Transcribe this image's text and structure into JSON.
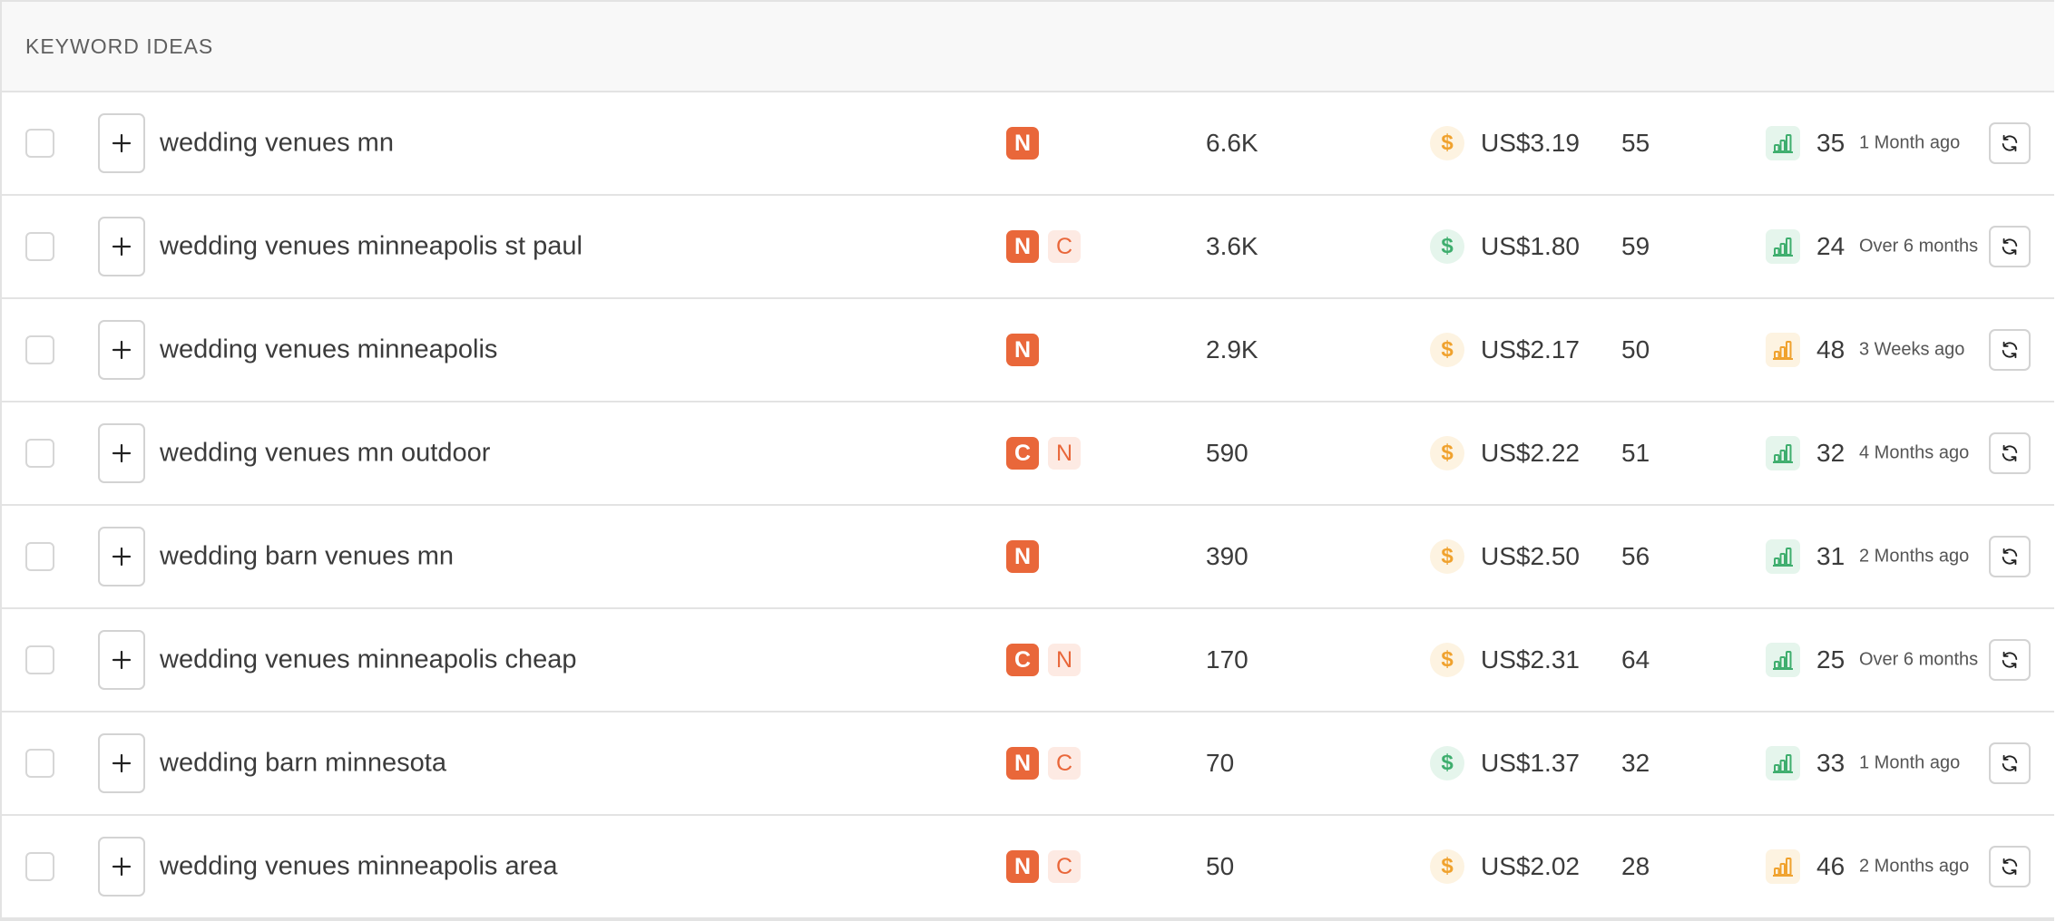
{
  "header": {
    "title": "KEYWORD IDEAS"
  },
  "colors": {
    "intent": "#e9673a",
    "green": "#3fae6e",
    "orange": "#f0a22e"
  },
  "rows": [
    {
      "keyword": "wedding venues mn",
      "intents": [
        "N"
      ],
      "volume": "6.6K",
      "cpc_level": "orange",
      "cpc": "US$3.19",
      "kd": "55",
      "trend_level": "green",
      "score": "35",
      "updated": "1 Month ago"
    },
    {
      "keyword": "wedding venues minneapolis st paul",
      "intents": [
        "N",
        "C"
      ],
      "volume": "3.6K",
      "cpc_level": "green",
      "cpc": "US$1.80",
      "kd": "59",
      "trend_level": "green",
      "score": "24",
      "updated": "Over 6 months"
    },
    {
      "keyword": "wedding venues minneapolis",
      "intents": [
        "N"
      ],
      "volume": "2.9K",
      "cpc_level": "orange",
      "cpc": "US$2.17",
      "kd": "50",
      "trend_level": "orange",
      "score": "48",
      "updated": "3 Weeks ago"
    },
    {
      "keyword": "wedding venues mn outdoor",
      "intents": [
        "C",
        "N"
      ],
      "volume": "590",
      "cpc_level": "orange",
      "cpc": "US$2.22",
      "kd": "51",
      "trend_level": "green",
      "score": "32",
      "updated": "4 Months ago"
    },
    {
      "keyword": "wedding barn venues mn",
      "intents": [
        "N"
      ],
      "volume": "390",
      "cpc_level": "orange",
      "cpc": "US$2.50",
      "kd": "56",
      "trend_level": "green",
      "score": "31",
      "updated": "2 Months ago"
    },
    {
      "keyword": "wedding venues minneapolis cheap",
      "intents": [
        "C",
        "N"
      ],
      "volume": "170",
      "cpc_level": "orange",
      "cpc": "US$2.31",
      "kd": "64",
      "trend_level": "green",
      "score": "25",
      "updated": "Over 6 months"
    },
    {
      "keyword": "wedding barn minnesota",
      "intents": [
        "N",
        "C"
      ],
      "volume": "70",
      "cpc_level": "green",
      "cpc": "US$1.37",
      "kd": "32",
      "trend_level": "green",
      "score": "33",
      "updated": "1 Month ago"
    },
    {
      "keyword": "wedding venues minneapolis area",
      "intents": [
        "N",
        "C"
      ],
      "volume": "50",
      "cpc_level": "orange",
      "cpc": "US$2.02",
      "kd": "28",
      "trend_level": "orange",
      "score": "46",
      "updated": "2 Months ago"
    }
  ],
  "icons": {
    "add": "plus-icon",
    "cpc": "dollar-icon",
    "trend": "bar-chart-icon",
    "refresh": "refresh-icon"
  },
  "dollar_symbol": "$"
}
